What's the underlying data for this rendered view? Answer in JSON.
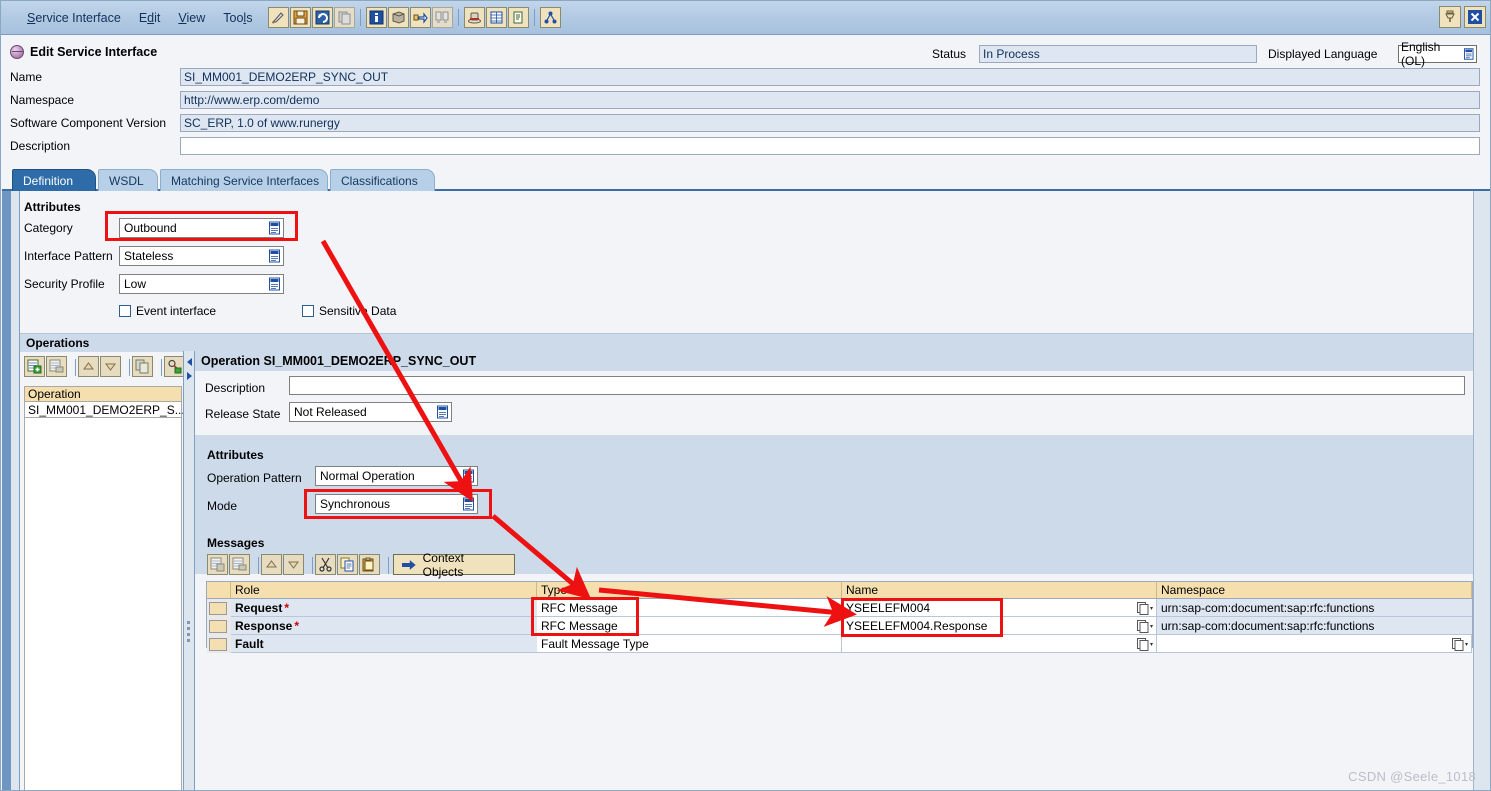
{
  "window": {
    "menus": [
      "Service Interface",
      "Edit",
      "View",
      "Tools"
    ],
    "toolbar_groups": [
      [
        "edit-pencil-icon",
        "save-icon",
        "refresh-icon",
        "copy-icon"
      ],
      [
        "info-icon",
        "book-icon",
        "where-used-icon",
        "compare-icon"
      ],
      [
        "hat-icon",
        "table-icon",
        "document-icon"
      ],
      [
        "network-icon"
      ]
    ],
    "window_buttons": [
      "pin-icon",
      "close-icon"
    ]
  },
  "header": {
    "title": "Edit Service Interface",
    "fields": [
      {
        "label": "Name",
        "value": "SI_MM001_DEMO2ERP_SYNC_OUT",
        "readonly": true
      },
      {
        "label": "Namespace",
        "value": "http://www.erp.com/demo",
        "readonly": true
      },
      {
        "label": "Software Component Version",
        "value": "SC_ERP, 1.0 of www.runergy",
        "readonly": true
      },
      {
        "label": "Description",
        "value": "",
        "readonly": false
      }
    ],
    "status_label": "Status",
    "status_value": "In Process",
    "language_label": "Displayed Language",
    "language_value": "English (OL)"
  },
  "tabs": [
    {
      "label": "Definition",
      "active": true
    },
    {
      "label": "WSDL",
      "active": false
    },
    {
      "label": "Matching Service Interfaces",
      "active": false
    },
    {
      "label": "Classifications",
      "active": false
    }
  ],
  "attributes": {
    "title": "Attributes",
    "fields": [
      {
        "label": "Category",
        "value": "Outbound",
        "highlighted": true
      },
      {
        "label": "Interface Pattern",
        "value": "Stateless",
        "highlighted": false
      },
      {
        "label": "Security Profile",
        "value": "Low",
        "highlighted": false
      }
    ],
    "checkboxes": [
      {
        "label": "Event interface",
        "checked": false
      },
      {
        "label": "Sensitive Data",
        "checked": false
      }
    ]
  },
  "operations": {
    "section_title": "Operations",
    "toolbar": [
      "insert-row-icon",
      "delete-row-icon",
      "move-up-icon",
      "move-down-icon",
      "copy-icon",
      "settings-icon"
    ],
    "list_header": "Operation",
    "list_items": [
      "SI_MM001_DEMO2ERP_S..."
    ],
    "detail_title": "Operation SI_MM001_DEMO2ERP_SYNC_OUT",
    "description_label": "Description",
    "description_value": "",
    "release_state_label": "Release State",
    "release_state_value": "Not Released",
    "attributes_title": "Attributes",
    "attr_fields": [
      {
        "label": "Operation Pattern",
        "value": "Normal Operation",
        "highlighted": false
      },
      {
        "label": "Mode",
        "value": "Synchronous",
        "highlighted": true
      }
    ]
  },
  "messages": {
    "section_title": "Messages",
    "toolbar": [
      "insert-row-icon",
      "delete-row-icon",
      "move-up-icon",
      "move-down-icon",
      "cut-icon",
      "copy-icon",
      "paste-icon"
    ],
    "context_objects_label": "Context Objects",
    "columns": [
      "Role",
      "Type",
      "Name",
      "Namespace"
    ],
    "rows": [
      {
        "role": "Request",
        "required": true,
        "type": "RFC Message",
        "name": "YSEELEFM004",
        "namespace": "urn:sap-com:document:sap:rfc:functions"
      },
      {
        "role": "Response",
        "required": true,
        "type": "RFC Message",
        "name": "YSEELEFM004.Response",
        "namespace": "urn:sap-com:document:sap:rfc:functions"
      },
      {
        "role": "Fault",
        "required": false,
        "type": "Fault Message Type",
        "name": "",
        "namespace": ""
      }
    ]
  },
  "watermark": "CSDN @Seele_1018",
  "colors": {
    "accent": "#2d6ca8",
    "annotation": "#ee1111",
    "header_field_bg": "#dde6f1",
    "table_header_bg": "#f5dfae"
  }
}
